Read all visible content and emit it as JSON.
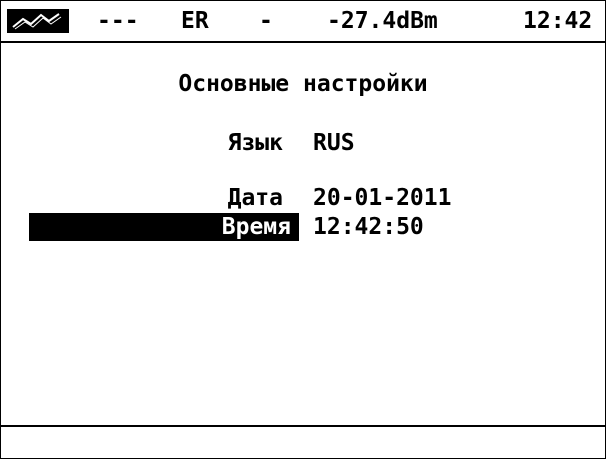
{
  "status_bar": {
    "icon": "signal-waveform-icon",
    "dashes": "---",
    "mode": "ER",
    "separator": "-",
    "power": "-27.4dBm",
    "clock": "12:42"
  },
  "main": {
    "title": "Основные настройки",
    "settings": [
      {
        "label": "Язык",
        "value": "RUS"
      },
      {
        "label": "Дата",
        "value": "20-01-2011"
      },
      {
        "label": "Время",
        "value": "12:42:50",
        "selected": true
      }
    ]
  },
  "colors": {
    "foreground": "#000000",
    "background": "#ffffff",
    "selection_bg": "#000000",
    "selection_fg": "#ffffff"
  }
}
